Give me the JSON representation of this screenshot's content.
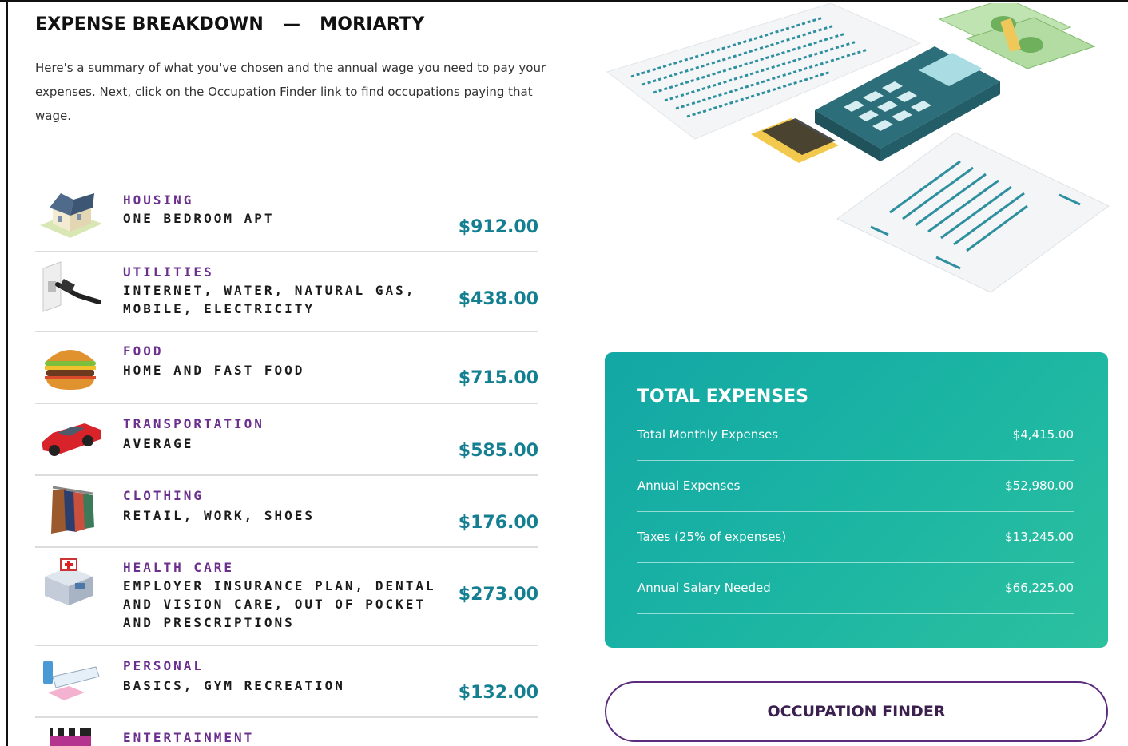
{
  "header": {
    "title": "EXPENSE BREAKDOWN",
    "separator": "—",
    "name": "MORIARTY"
  },
  "intro": "Here's a summary of what you've chosen and the annual wage you need to pay your expenses. Next, click on the Occupation Finder link to find occupations paying that wage.",
  "expenses": [
    {
      "icon": "house-icon",
      "category": "HOUSING",
      "description": "ONE BEDROOM APT",
      "amount": "$912.00"
    },
    {
      "icon": "power-plug-icon",
      "category": "UTILITIES",
      "description": "INTERNET, WATER, NATURAL GAS, MOBILE, ELECTRICITY",
      "amount": "$438.00"
    },
    {
      "icon": "burger-icon",
      "category": "FOOD",
      "description": "HOME AND FAST FOOD",
      "amount": "$715.00"
    },
    {
      "icon": "car-icon",
      "category": "TRANSPORTATION",
      "description": "AVERAGE",
      "amount": "$585.00"
    },
    {
      "icon": "clothes-rack-icon",
      "category": "CLOTHING",
      "description": "RETAIL, WORK, SHOES",
      "amount": "$176.00"
    },
    {
      "icon": "hospital-icon",
      "category": "HEALTH CARE",
      "description": "EMPLOYER INSURANCE PLAN, DENTAL AND VISION CARE, OUT OF POCKET AND PRESCRIPTIONS",
      "amount": "$273.00"
    },
    {
      "icon": "toiletries-icon",
      "category": "PERSONAL",
      "description": "BASICS, GYM RECREATION",
      "amount": "$132.00"
    },
    {
      "icon": "clapperboard-icon",
      "category": "ENTERTAINMENT",
      "description": "",
      "amount": ""
    }
  ],
  "totals": {
    "title": "TOTAL EXPENSES",
    "rows": [
      {
        "label": "Total Monthly Expenses",
        "value": "$4,415.00"
      },
      {
        "label": "Annual Expenses",
        "value": "$52,980.00"
      },
      {
        "label": "Taxes (25% of expenses)",
        "value": "$13,245.00"
      },
      {
        "label": "Annual Salary Needed",
        "value": "$66,225.00"
      }
    ]
  },
  "finder_button": "OCCUPATION FINDER",
  "colors": {
    "category": "#6b2f8e",
    "amount": "#157f92",
    "panel": "#19b0a4",
    "button_border": "#5b2c7e"
  }
}
